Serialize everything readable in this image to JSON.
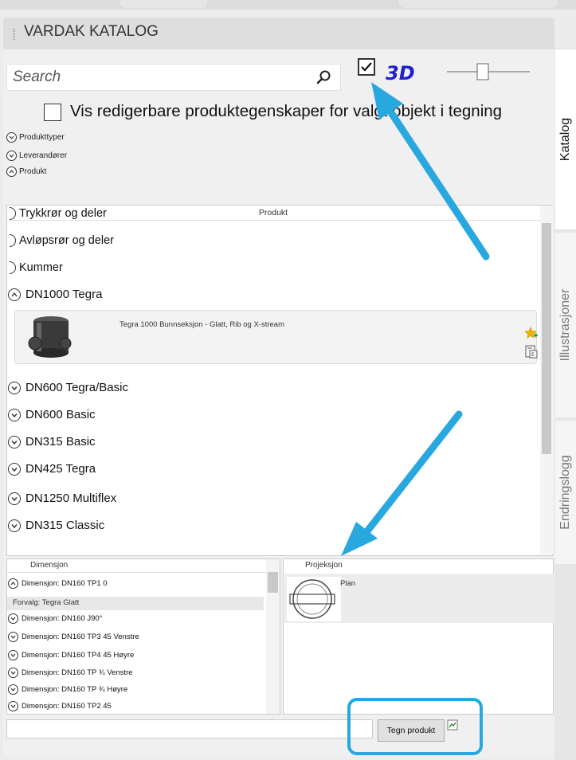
{
  "panel": {
    "title": "VARDAK KATALOG"
  },
  "search": {
    "placeholder": "Search"
  },
  "view3d": {
    "label": "3D",
    "checked": true
  },
  "editable": {
    "label": "Vis redigerbare produktegenskaper for valgt objekt i tegning",
    "checked": false
  },
  "filters": [
    {
      "label": "Produkttyper",
      "state": "collapsed"
    },
    {
      "label": "Leverandører",
      "state": "collapsed"
    },
    {
      "label": "Produkt",
      "state": "expanded"
    }
  ],
  "product_list": {
    "header": "Produkt",
    "categories": [
      "Trykkrør og deler",
      "Avløpsrør og deler",
      "Kummer",
      "DN1000 Tegra",
      "DN600 Tegra/Basic",
      "DN600 Basic",
      "DN315 Basic",
      "DN425 Tegra",
      "DN1250 Multiflex",
      "DN315 Classic"
    ],
    "selected_item": {
      "name": "Tegra 1000 Bunnseksjon - Glatt, Rib og X-stream"
    }
  },
  "dimension": {
    "header": "Dimensjon",
    "default_label": "Forvalg: Tegra Glatt",
    "rows": [
      "Dimensjon: DN160 TP1 0",
      "Dimensjon: DN160 J90°",
      "Dimensjon: DN160 TP3 45 Venstre",
      "Dimensjon: DN160 TP4 45 Høyre",
      "Dimensjon: DN160 TP ¾ Venstre",
      "Dimensjon: DN160 TP ¾ Høyre",
      "Dimensjon: DN160 TP2 45"
    ]
  },
  "projection": {
    "header": "Projeksjon",
    "item": "Plan"
  },
  "actions": {
    "draw_label": "Tegn produkt"
  },
  "side_tabs": [
    "Katalog",
    "Illustrasjoner",
    "Endringslogg"
  ],
  "colors": {
    "annotation_blue": "#29a8e0",
    "label_3d": "#1f1fd0"
  },
  "icons": [
    "search-icon",
    "checkbox-icon",
    "expand-circle-icon",
    "collapse-circle-icon",
    "star-add-icon",
    "calculator-icon",
    "draw-icon"
  ]
}
